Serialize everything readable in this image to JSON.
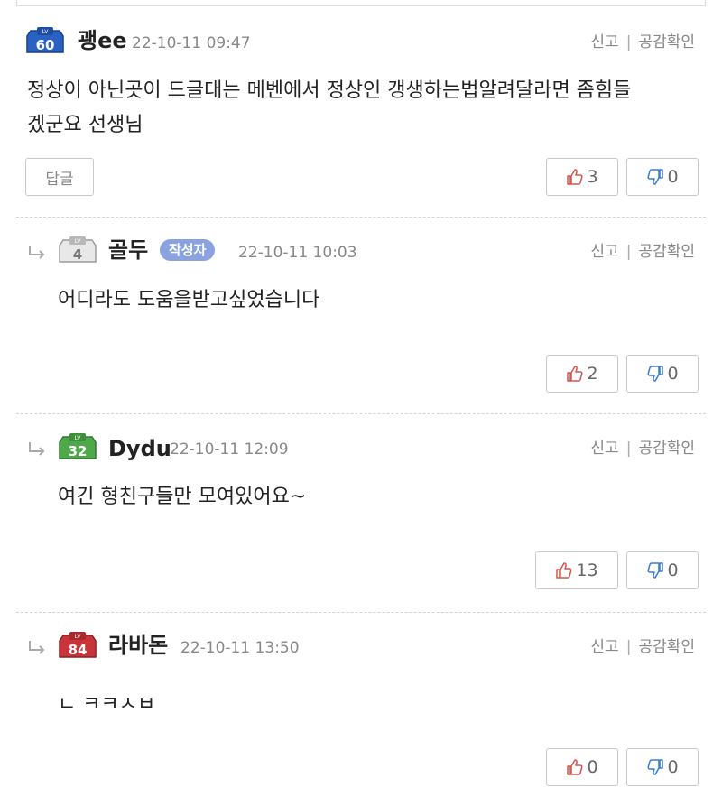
{
  "comments": [
    {
      "level": "60",
      "level_color": "#2a62c4",
      "author": "괭ee",
      "is_op": false,
      "date": "22-10-11 09:47",
      "body_line1": "정상이 아닌곳이 드글대는 메벤에서 정상인 갱생하는법알려달라면 좀힘들",
      "body_line2": "겠군요 선생님",
      "up": "3",
      "down": "0",
      "reply": "답글"
    },
    {
      "level": "4",
      "level_color": "#9c9c9c",
      "author": "골두",
      "is_op": true,
      "op_label": "작성자",
      "date": "22-10-11 10:03",
      "body_line1": "어디라도 도움을받고싶었습니다",
      "up": "2",
      "down": "0"
    },
    {
      "level": "32",
      "level_color": "#4fa84a",
      "author": "Dydu",
      "is_op": false,
      "date": "22-10-11 12:09",
      "body_line1": "여긴 형친구들만 모여있어요~",
      "up": "13",
      "down": "0"
    },
    {
      "level": "84",
      "level_color": "#c8343a",
      "author": "라바돈",
      "is_op": false,
      "date": "22-10-11 13:50",
      "body_line1": "ㄴ ㅋㅋㅅㅂ",
      "up": "0",
      "down": "0"
    }
  ],
  "actions": {
    "report": "신고",
    "agree_check": "공감확인"
  },
  "level_prefix": "LV"
}
